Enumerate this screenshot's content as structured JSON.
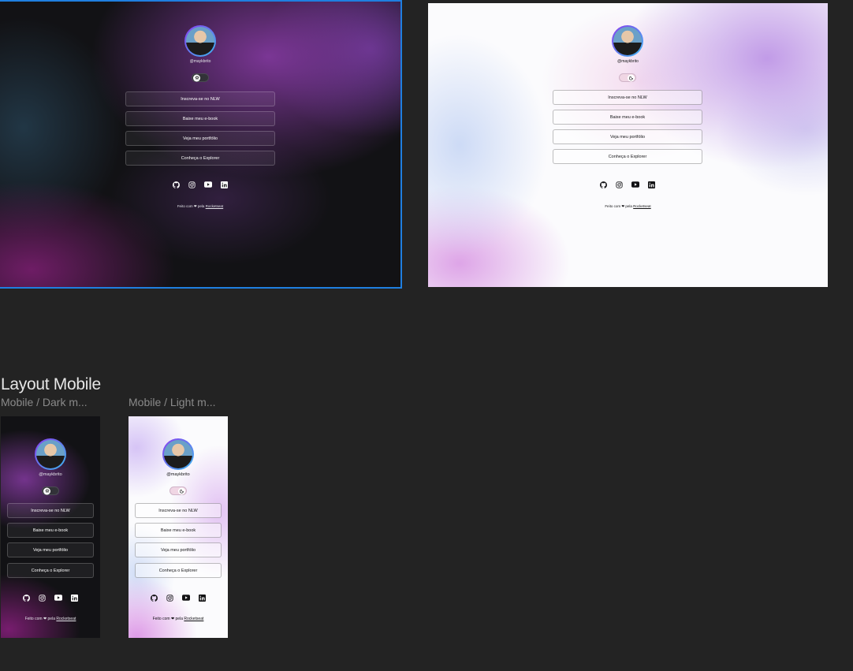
{
  "profile": {
    "handle": "@maykbrito"
  },
  "links": {
    "nlw": "Inscreva-se no NLW",
    "ebook": "Baixe meu e-book",
    "portfolio": "Veja meu portfólio",
    "explorer": "Conheça o Explorer"
  },
  "footer": {
    "prefix": "Feito com",
    "heart": "❤",
    "middle": "pela",
    "link": "Rocketseat"
  },
  "section": {
    "title": "Layout Mobile"
  },
  "frames": {
    "mobile_dark_label": "Mobile / Dark m...",
    "mobile_light_label": "Mobile / Light m..."
  },
  "icons": [
    "github-icon",
    "instagram-icon",
    "youtube-icon",
    "linkedin-icon"
  ],
  "colors": {
    "canvas": "#232323",
    "selection": "#1f7fe0",
    "dark_bg": "#121215",
    "accent_purple": "#8a3cf0",
    "accent_blue": "#3cb8f0"
  }
}
